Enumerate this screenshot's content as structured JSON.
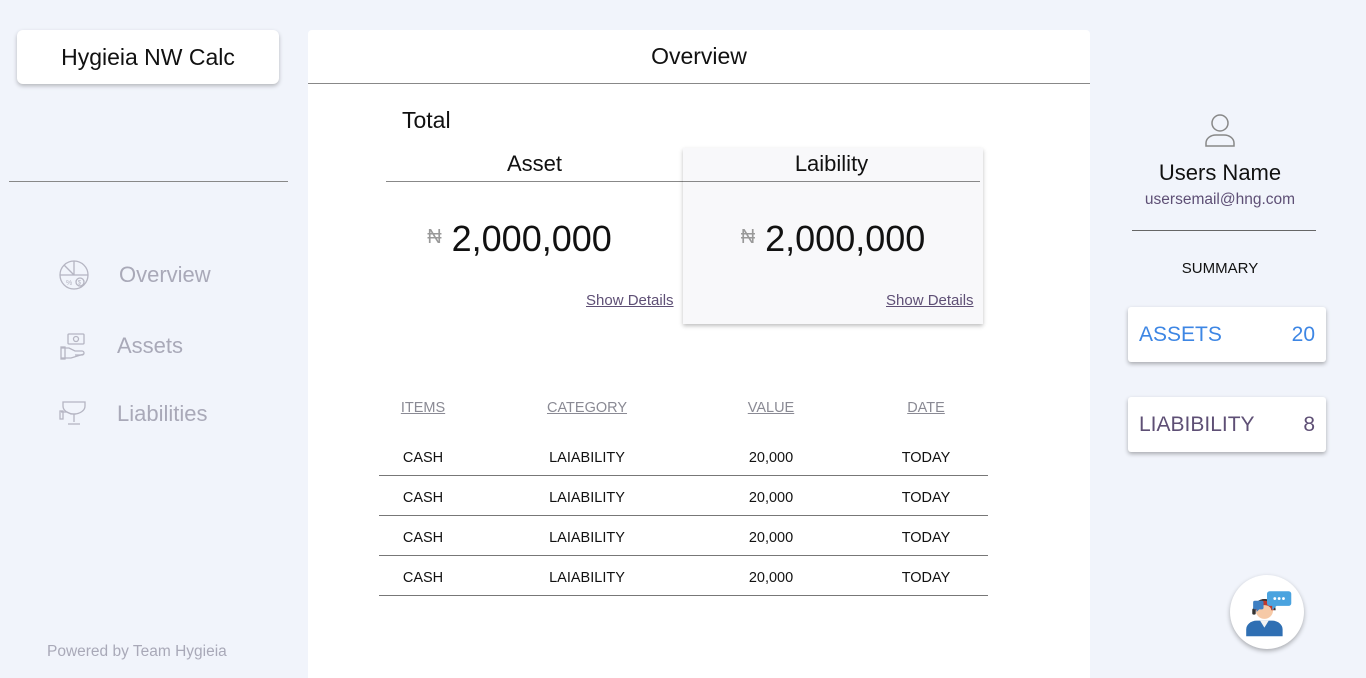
{
  "app": {
    "title": "Hygieia NW Calc",
    "powered_by": "Powered by Team Hygieia"
  },
  "sidebar": {
    "items": [
      {
        "label": "Overview",
        "icon": "overview-icon"
      },
      {
        "label": "Assets",
        "icon": "assets-icon"
      },
      {
        "label": "Liabilities",
        "icon": "liabilities-icon"
      }
    ]
  },
  "main": {
    "header": "Overview",
    "total_label": "Total",
    "asset": {
      "title": "Asset",
      "currency": "₦",
      "amount": "2,000,000",
      "link": "Show Details"
    },
    "liability": {
      "title": "Laibility",
      "currency": "₦",
      "amount": "2,000,000",
      "link": "Show Details"
    },
    "table": {
      "headers": [
        "ITEMS",
        "CATEGORY",
        "VALUE",
        "DATE"
      ],
      "rows": [
        [
          "CASH",
          "LAIABILITY",
          "20,000",
          "TODAY"
        ],
        [
          "CASH",
          "LAIABILITY",
          "20,000",
          "TODAY"
        ],
        [
          "CASH",
          "LAIABILITY",
          "20,000",
          "TODAY"
        ],
        [
          "CASH",
          "LAIABILITY",
          "20,000",
          "TODAY"
        ]
      ]
    }
  },
  "user": {
    "name": "Users Name",
    "email": "usersemail@hng.com",
    "icon": "user-icon"
  },
  "summary": {
    "label": "SUMMARY",
    "assets": {
      "label": "ASSETS",
      "count": "20"
    },
    "liability": {
      "label": "LIABIBILITY",
      "count": "8"
    }
  },
  "support": {
    "icon": "support-agent-icon"
  },
  "colors": {
    "background": "#f1f4fb",
    "accent_blue": "#3d86e4",
    "accent_purple": "#5e4f75",
    "muted": "#a9a9b8"
  }
}
